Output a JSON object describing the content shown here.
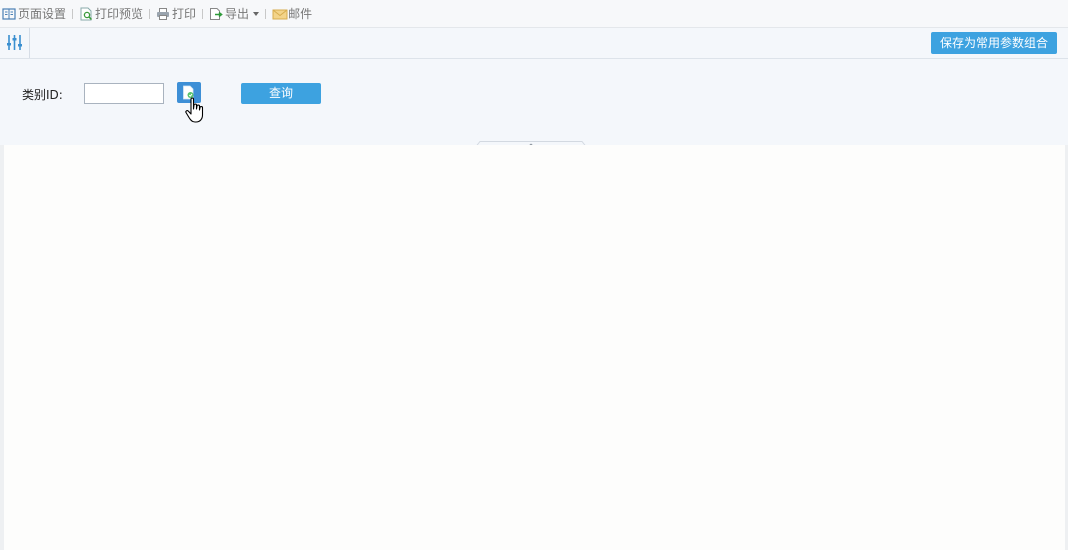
{
  "toolbar": {
    "items": [
      {
        "label": "页面设置",
        "icon": "page-setup-icon"
      },
      {
        "label": "打印预览",
        "icon": "print-preview-icon"
      },
      {
        "label": "打印",
        "icon": "printer-icon"
      },
      {
        "label": "导出",
        "icon": "export-icon"
      },
      {
        "label": "邮件",
        "icon": "mail-icon"
      }
    ]
  },
  "param_bar": {
    "toggle_icon": "sliders-icon",
    "save_label": "保存为常用参数组合"
  },
  "form": {
    "category_label": "类别ID:",
    "category_value": "",
    "query_label": "查询",
    "picker_icon": "select-file-icon"
  },
  "colors": {
    "accent": "#3da2e0",
    "panel_bg": "#f4f7fb",
    "body_bg": "#fdfdfc"
  }
}
